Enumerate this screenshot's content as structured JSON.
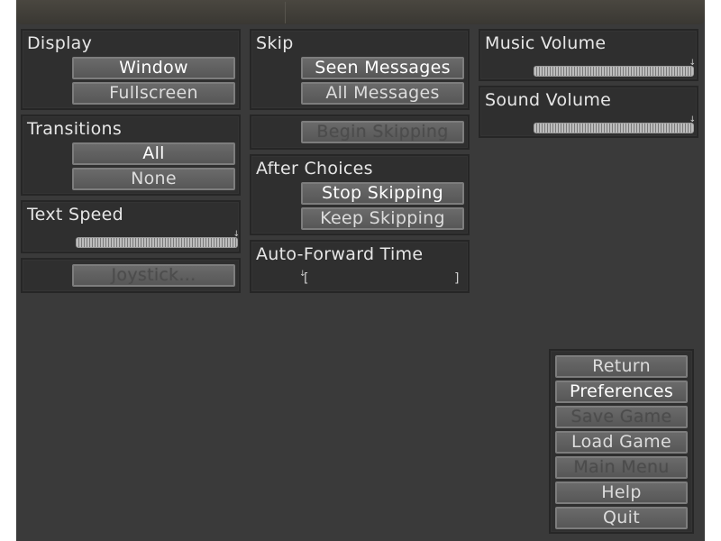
{
  "display": {
    "label": "Display",
    "options": [
      "Window",
      "Fullscreen"
    ],
    "selected": "Window"
  },
  "transitions": {
    "label": "Transitions",
    "options": [
      "All",
      "None"
    ],
    "selected": "All"
  },
  "text_speed": {
    "label": "Text Speed",
    "level": 1.0
  },
  "joystick": {
    "label": "Joystick..."
  },
  "skip": {
    "label": "Skip",
    "options": [
      "Seen Messages",
      "All Messages"
    ],
    "selected": "Seen Messages"
  },
  "begin_skipping": {
    "label": "Begin Skipping"
  },
  "after_choices": {
    "label": "After Choices",
    "options": [
      "Stop Skipping",
      "Keep Skipping"
    ],
    "selected": "Stop Skipping"
  },
  "auto_forward": {
    "label": "Auto-Forward Time",
    "level": 0.0
  },
  "music_volume": {
    "label": "Music Volume",
    "level": 1.0
  },
  "sound_volume": {
    "label": "Sound Volume",
    "level": 1.0
  },
  "nav": {
    "items": [
      {
        "label": "Return",
        "state": "normal"
      },
      {
        "label": "Preferences",
        "state": "selected"
      },
      {
        "label": "Save Game",
        "state": "disabled"
      },
      {
        "label": "Load Game",
        "state": "normal"
      },
      {
        "label": "Main Menu",
        "state": "disabled"
      },
      {
        "label": "Help",
        "state": "normal"
      },
      {
        "label": "Quit",
        "state": "normal"
      }
    ]
  }
}
